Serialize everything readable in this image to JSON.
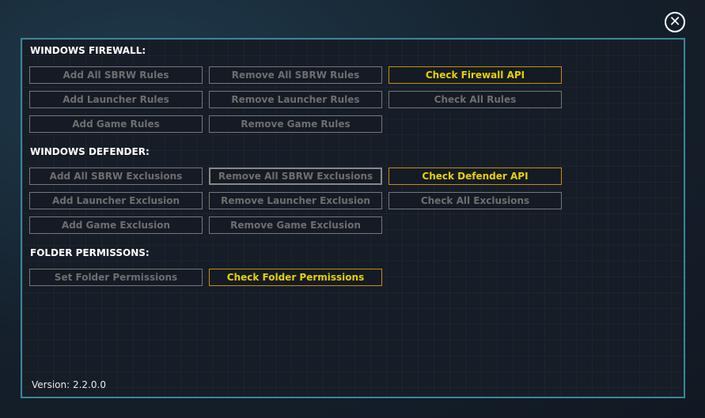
{
  "close_icon": "close-circle-icon",
  "firewall": {
    "title": "WINDOWS FIREWALL:",
    "buttons": [
      "Add All SBRW Rules",
      "Remove All SBRW Rules",
      "Check Firewall API",
      "Add Launcher Rules",
      "Remove Launcher Rules",
      "Check All Rules",
      "Add Game Rules",
      "Remove Game Rules"
    ]
  },
  "defender": {
    "title": "WINDOWS DEFENDER:",
    "buttons": [
      "Add All SBRW Exclusions",
      "Remove All SBRW Exclusions",
      "Check Defender API",
      "Add Launcher Exclusion",
      "Remove Launcher Exclusion",
      "Check All Exclusions",
      "Add Game Exclusion",
      "Remove Game Exclusion"
    ]
  },
  "folder": {
    "title": "FOLDER PERMISSONS:",
    "buttons": [
      "Set Folder Permissions",
      "Check Folder Permissions"
    ]
  },
  "version": "Version: 2.2.0.0",
  "colors": {
    "accent": "#e6d100",
    "accent_border": "#c98d16",
    "panel_border": "#3b8797"
  }
}
